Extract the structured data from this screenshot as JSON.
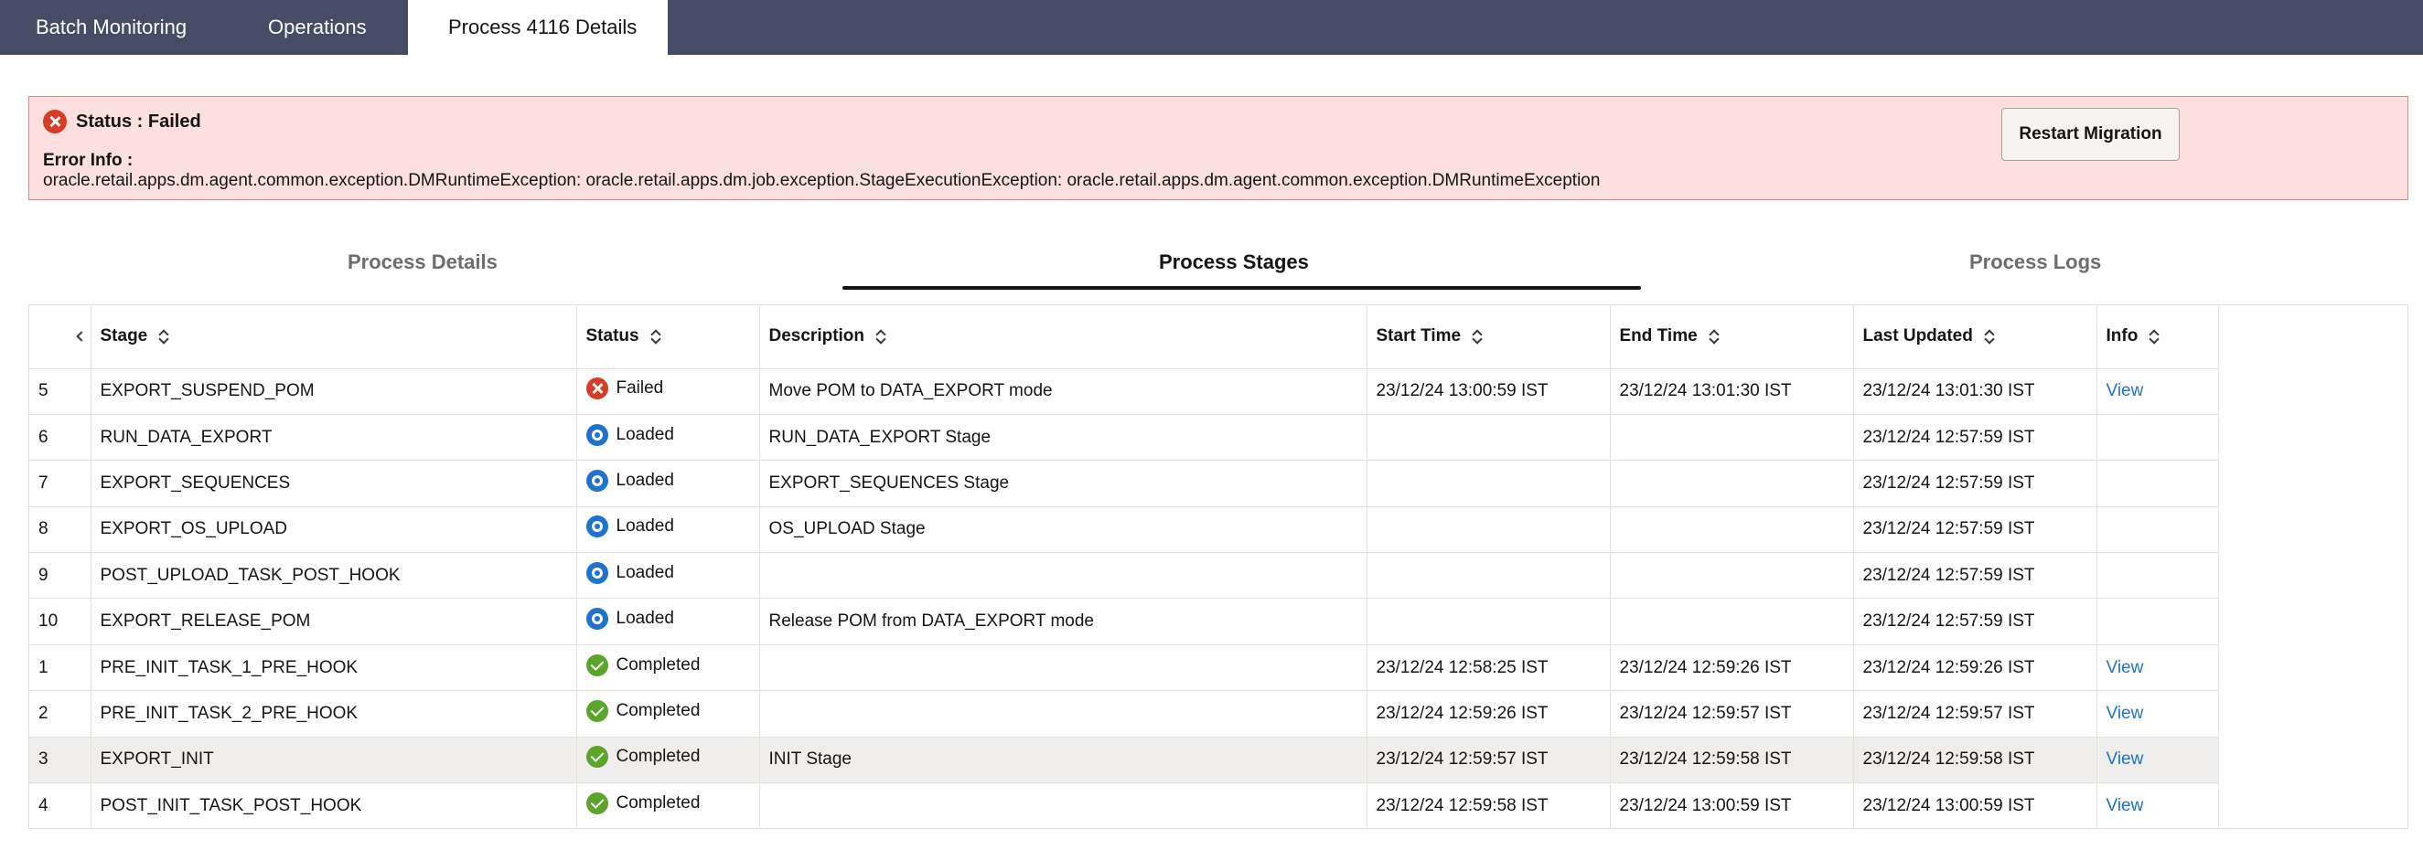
{
  "top_tabs": {
    "batch_monitoring": "Batch Monitoring",
    "operations": "Operations",
    "process_details": "Process 4116 Details"
  },
  "banner": {
    "status": "Status : Failed",
    "error_label": "Error Info :",
    "error_message": "oracle.retail.apps.dm.agent.common.exception.DMRuntimeException: oracle.retail.apps.dm.job.exception.StageExecutionException: oracle.retail.apps.dm.agent.common.exception.DMRuntimeException",
    "restart_label": "Restart Migration",
    "icon": "error-circle-icon"
  },
  "sub_tabs": {
    "details": "Process Details",
    "stages": "Process Stages",
    "logs": "Process Logs",
    "selected": "Process Stages"
  },
  "table": {
    "headers": {
      "stage": "Stage",
      "status": "Status",
      "description": "Description",
      "start_time": "Start Time",
      "end_time": "End Time",
      "last_updated": "Last Updated",
      "info": "Info"
    },
    "rows": [
      {
        "num": "5",
        "stage": "EXPORT_SUSPEND_POM",
        "status": "Failed",
        "description": "Move POM to DATA_EXPORT mode",
        "start": "23/12/24 13:00:59 IST",
        "end": "23/12/24 13:01:30 IST",
        "updated": "23/12/24 13:01:30 IST",
        "info": "View"
      },
      {
        "num": "6",
        "stage": "RUN_DATA_EXPORT",
        "status": "Loaded",
        "description": "RUN_DATA_EXPORT Stage",
        "start": "",
        "end": "",
        "updated": "23/12/24 12:57:59 IST",
        "info": ""
      },
      {
        "num": "7",
        "stage": "EXPORT_SEQUENCES",
        "status": "Loaded",
        "description": "EXPORT_SEQUENCES Stage",
        "start": "",
        "end": "",
        "updated": "23/12/24 12:57:59 IST",
        "info": ""
      },
      {
        "num": "8",
        "stage": "EXPORT_OS_UPLOAD",
        "status": "Loaded",
        "description": "OS_UPLOAD Stage",
        "start": "",
        "end": "",
        "updated": "23/12/24 12:57:59 IST",
        "info": ""
      },
      {
        "num": "9",
        "stage": "POST_UPLOAD_TASK_POST_HOOK",
        "status": "Loaded",
        "description": "",
        "start": "",
        "end": "",
        "updated": "23/12/24 12:57:59 IST",
        "info": ""
      },
      {
        "num": "10",
        "stage": "EXPORT_RELEASE_POM",
        "status": "Loaded",
        "description": "Release POM from DATA_EXPORT mode",
        "start": "",
        "end": "",
        "updated": "23/12/24 12:57:59 IST",
        "info": ""
      },
      {
        "num": "1",
        "stage": "PRE_INIT_TASK_1_PRE_HOOK",
        "status": "Completed",
        "description": "",
        "start": "23/12/24 12:58:25 IST",
        "end": "23/12/24 12:59:26 IST",
        "updated": "23/12/24 12:59:26 IST",
        "info": "View"
      },
      {
        "num": "2",
        "stage": "PRE_INIT_TASK_2_PRE_HOOK",
        "status": "Completed",
        "description": "",
        "start": "23/12/24 12:59:26 IST",
        "end": "23/12/24 12:59:57 IST",
        "updated": "23/12/24 12:59:57 IST",
        "info": "View"
      },
      {
        "num": "3",
        "stage": "EXPORT_INIT",
        "status": "Completed",
        "description": "INIT Stage",
        "start": "23/12/24 12:59:57 IST",
        "end": "23/12/24 12:59:58 IST",
        "updated": "23/12/24 12:59:58 IST",
        "info": "View",
        "highlighted": true
      },
      {
        "num": "4",
        "stage": "POST_INIT_TASK_POST_HOOK",
        "status": "Completed",
        "description": "",
        "start": "23/12/24 12:59:58 IST",
        "end": "23/12/24 13:00:59 IST",
        "updated": "23/12/24 13:00:59 IST",
        "info": "View"
      }
    ]
  },
  "colors": {
    "topbar": "#474c66",
    "error_bg": "#fcdfdf",
    "error_border": "#d88c8c",
    "failed": "#d63b25",
    "loaded": "#1f73cf",
    "completed": "#5ba52a",
    "link": "#1f73cf"
  }
}
